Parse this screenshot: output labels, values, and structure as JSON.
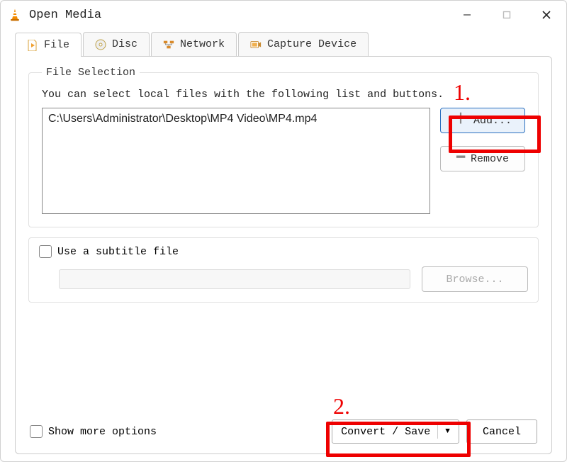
{
  "window": {
    "title": "Open Media"
  },
  "tabs": {
    "file": "File",
    "disc": "Disc",
    "network": "Network",
    "capture": "Capture Device"
  },
  "fileSelection": {
    "legend": "File Selection",
    "help": "You can select local files with the following list and buttons.",
    "files": [
      "C:\\Users\\Administrator\\Desktop\\MP4 Video\\MP4.mp4"
    ],
    "addLabel": "Add...",
    "removeLabel": "Remove"
  },
  "subtitle": {
    "label": "Use a subtitle file",
    "browseLabel": "Browse..."
  },
  "footer": {
    "showMoreLabel": "Show more options",
    "convertLabel": "Convert / Save",
    "cancelLabel": "Cancel"
  },
  "annotations": {
    "one": "1.",
    "two": "2."
  }
}
